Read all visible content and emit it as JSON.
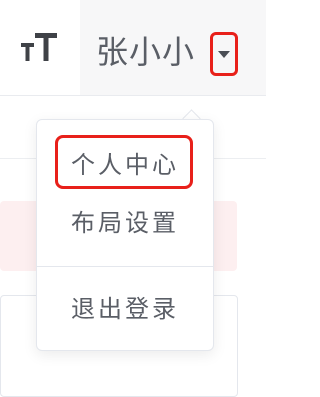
{
  "header": {
    "font_size_icon": "font-size-icon",
    "user_name": "张小小",
    "dropdown_icon": "caret-down-icon",
    "highlight_color": "#e8201a"
  },
  "user_menu": {
    "items": [
      {
        "label": "个人中心"
      },
      {
        "label": "布局设置"
      },
      {
        "label": "退出登录"
      }
    ]
  }
}
